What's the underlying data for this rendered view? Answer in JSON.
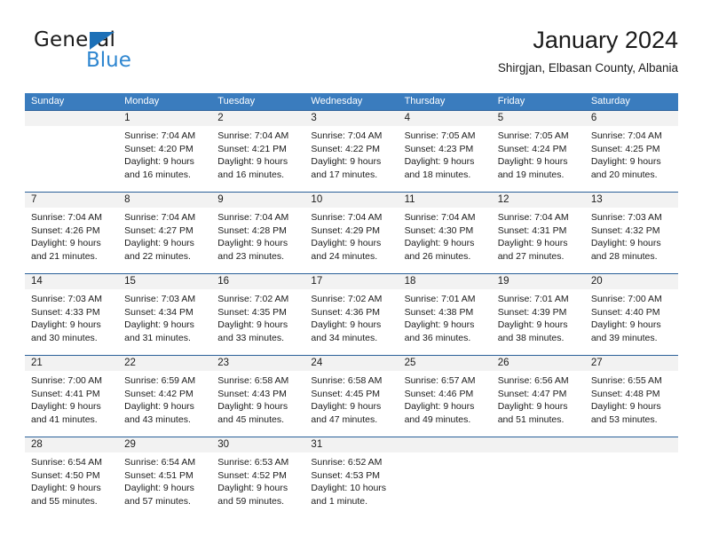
{
  "logo": {
    "word1": "General",
    "word2": "Blue",
    "triangle_color": "#1d70b7",
    "blue_text_color": "#2e86d0"
  },
  "header": {
    "title": "January 2024",
    "subtitle": "Shirgjan, Elbasan County, Albania"
  },
  "theme": {
    "header_row_bg": "#3a7cbe",
    "header_row_text": "#ffffff",
    "daynum_band_bg": "#f2f2f2",
    "row_divider": "#2a6099",
    "text": "#1b1b1b"
  },
  "weekdays": [
    "Sunday",
    "Monday",
    "Tuesday",
    "Wednesday",
    "Thursday",
    "Friday",
    "Saturday"
  ],
  "weeks": [
    [
      {
        "day": "",
        "l1": "",
        "l2": "",
        "l3": "",
        "l4": ""
      },
      {
        "day": "1",
        "l1": "Sunrise: 7:04 AM",
        "l2": "Sunset: 4:20 PM",
        "l3": "Daylight: 9 hours",
        "l4": "and 16 minutes."
      },
      {
        "day": "2",
        "l1": "Sunrise: 7:04 AM",
        "l2": "Sunset: 4:21 PM",
        "l3": "Daylight: 9 hours",
        "l4": "and 16 minutes."
      },
      {
        "day": "3",
        "l1": "Sunrise: 7:04 AM",
        "l2": "Sunset: 4:22 PM",
        "l3": "Daylight: 9 hours",
        "l4": "and 17 minutes."
      },
      {
        "day": "4",
        "l1": "Sunrise: 7:05 AM",
        "l2": "Sunset: 4:23 PM",
        "l3": "Daylight: 9 hours",
        "l4": "and 18 minutes."
      },
      {
        "day": "5",
        "l1": "Sunrise: 7:05 AM",
        "l2": "Sunset: 4:24 PM",
        "l3": "Daylight: 9 hours",
        "l4": "and 19 minutes."
      },
      {
        "day": "6",
        "l1": "Sunrise: 7:04 AM",
        "l2": "Sunset: 4:25 PM",
        "l3": "Daylight: 9 hours",
        "l4": "and 20 minutes."
      }
    ],
    [
      {
        "day": "7",
        "l1": "Sunrise: 7:04 AM",
        "l2": "Sunset: 4:26 PM",
        "l3": "Daylight: 9 hours",
        "l4": "and 21 minutes."
      },
      {
        "day": "8",
        "l1": "Sunrise: 7:04 AM",
        "l2": "Sunset: 4:27 PM",
        "l3": "Daylight: 9 hours",
        "l4": "and 22 minutes."
      },
      {
        "day": "9",
        "l1": "Sunrise: 7:04 AM",
        "l2": "Sunset: 4:28 PM",
        "l3": "Daylight: 9 hours",
        "l4": "and 23 minutes."
      },
      {
        "day": "10",
        "l1": "Sunrise: 7:04 AM",
        "l2": "Sunset: 4:29 PM",
        "l3": "Daylight: 9 hours",
        "l4": "and 24 minutes."
      },
      {
        "day": "11",
        "l1": "Sunrise: 7:04 AM",
        "l2": "Sunset: 4:30 PM",
        "l3": "Daylight: 9 hours",
        "l4": "and 26 minutes."
      },
      {
        "day": "12",
        "l1": "Sunrise: 7:04 AM",
        "l2": "Sunset: 4:31 PM",
        "l3": "Daylight: 9 hours",
        "l4": "and 27 minutes."
      },
      {
        "day": "13",
        "l1": "Sunrise: 7:03 AM",
        "l2": "Sunset: 4:32 PM",
        "l3": "Daylight: 9 hours",
        "l4": "and 28 minutes."
      }
    ],
    [
      {
        "day": "14",
        "l1": "Sunrise: 7:03 AM",
        "l2": "Sunset: 4:33 PM",
        "l3": "Daylight: 9 hours",
        "l4": "and 30 minutes."
      },
      {
        "day": "15",
        "l1": "Sunrise: 7:03 AM",
        "l2": "Sunset: 4:34 PM",
        "l3": "Daylight: 9 hours",
        "l4": "and 31 minutes."
      },
      {
        "day": "16",
        "l1": "Sunrise: 7:02 AM",
        "l2": "Sunset: 4:35 PM",
        "l3": "Daylight: 9 hours",
        "l4": "and 33 minutes."
      },
      {
        "day": "17",
        "l1": "Sunrise: 7:02 AM",
        "l2": "Sunset: 4:36 PM",
        "l3": "Daylight: 9 hours",
        "l4": "and 34 minutes."
      },
      {
        "day": "18",
        "l1": "Sunrise: 7:01 AM",
        "l2": "Sunset: 4:38 PM",
        "l3": "Daylight: 9 hours",
        "l4": "and 36 minutes."
      },
      {
        "day": "19",
        "l1": "Sunrise: 7:01 AM",
        "l2": "Sunset: 4:39 PM",
        "l3": "Daylight: 9 hours",
        "l4": "and 38 minutes."
      },
      {
        "day": "20",
        "l1": "Sunrise: 7:00 AM",
        "l2": "Sunset: 4:40 PM",
        "l3": "Daylight: 9 hours",
        "l4": "and 39 minutes."
      }
    ],
    [
      {
        "day": "21",
        "l1": "Sunrise: 7:00 AM",
        "l2": "Sunset: 4:41 PM",
        "l3": "Daylight: 9 hours",
        "l4": "and 41 minutes."
      },
      {
        "day": "22",
        "l1": "Sunrise: 6:59 AM",
        "l2": "Sunset: 4:42 PM",
        "l3": "Daylight: 9 hours",
        "l4": "and 43 minutes."
      },
      {
        "day": "23",
        "l1": "Sunrise: 6:58 AM",
        "l2": "Sunset: 4:43 PM",
        "l3": "Daylight: 9 hours",
        "l4": "and 45 minutes."
      },
      {
        "day": "24",
        "l1": "Sunrise: 6:58 AM",
        "l2": "Sunset: 4:45 PM",
        "l3": "Daylight: 9 hours",
        "l4": "and 47 minutes."
      },
      {
        "day": "25",
        "l1": "Sunrise: 6:57 AM",
        "l2": "Sunset: 4:46 PM",
        "l3": "Daylight: 9 hours",
        "l4": "and 49 minutes."
      },
      {
        "day": "26",
        "l1": "Sunrise: 6:56 AM",
        "l2": "Sunset: 4:47 PM",
        "l3": "Daylight: 9 hours",
        "l4": "and 51 minutes."
      },
      {
        "day": "27",
        "l1": "Sunrise: 6:55 AM",
        "l2": "Sunset: 4:48 PM",
        "l3": "Daylight: 9 hours",
        "l4": "and 53 minutes."
      }
    ],
    [
      {
        "day": "28",
        "l1": "Sunrise: 6:54 AM",
        "l2": "Sunset: 4:50 PM",
        "l3": "Daylight: 9 hours",
        "l4": "and 55 minutes."
      },
      {
        "day": "29",
        "l1": "Sunrise: 6:54 AM",
        "l2": "Sunset: 4:51 PM",
        "l3": "Daylight: 9 hours",
        "l4": "and 57 minutes."
      },
      {
        "day": "30",
        "l1": "Sunrise: 6:53 AM",
        "l2": "Sunset: 4:52 PM",
        "l3": "Daylight: 9 hours",
        "l4": "and 59 minutes."
      },
      {
        "day": "31",
        "l1": "Sunrise: 6:52 AM",
        "l2": "Sunset: 4:53 PM",
        "l3": "Daylight: 10 hours",
        "l4": "and 1 minute."
      },
      {
        "day": "",
        "l1": "",
        "l2": "",
        "l3": "",
        "l4": ""
      },
      {
        "day": "",
        "l1": "",
        "l2": "",
        "l3": "",
        "l4": ""
      },
      {
        "day": "",
        "l1": "",
        "l2": "",
        "l3": "",
        "l4": ""
      }
    ]
  ]
}
